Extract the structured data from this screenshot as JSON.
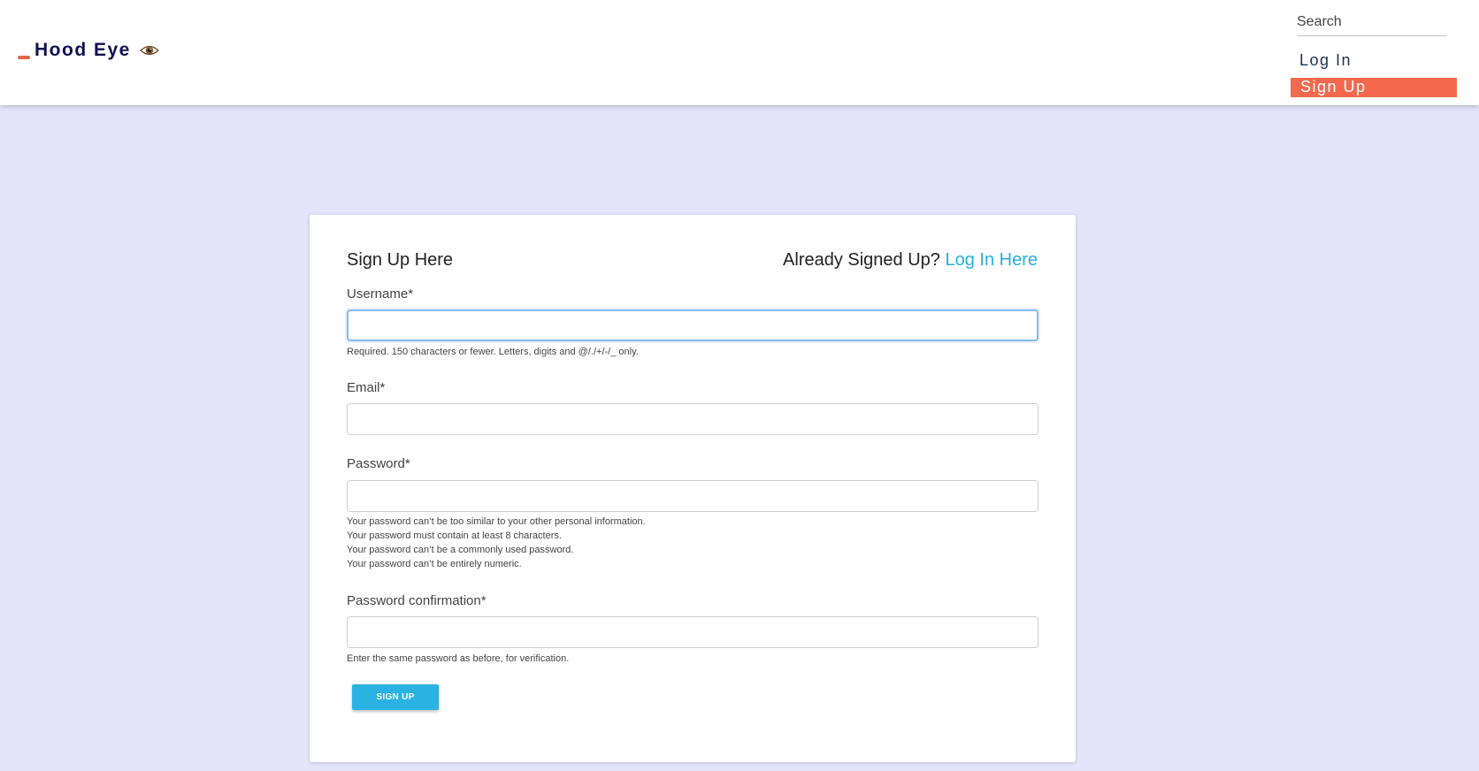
{
  "brand": {
    "name": "Hood Eye",
    "icon": "eye-icon"
  },
  "nav": {
    "search_placeholder": "Search",
    "login_label": "Log In",
    "signup_label": "Sign Up"
  },
  "form": {
    "title": "Sign Up Here",
    "already_text": "Already Signed Up?",
    "login_link": "Log In Here",
    "username_label": "Username*",
    "username_value": "",
    "username_help": "Required. 150 characters or fewer. Letters, digits and @/./+/-/_ only.",
    "email_label": "Email*",
    "email_value": "",
    "password_label": "Password*",
    "password_value": "",
    "password_help": [
      "Your password can’t be too similar to your other personal information.",
      "Your password must contain at least 8 characters.",
      "Your password can’t be a commonly used password.",
      "Your password can’t be entirely numeric."
    ],
    "confirm_label": "Password confirmation*",
    "confirm_value": "",
    "confirm_help": "Enter the same password as before, for verification.",
    "submit_label": "SIGN UP"
  },
  "colors": {
    "background": "#e4e4fb",
    "brand_text": "#10104f",
    "accent_orange": "#f4694e",
    "link_blue": "#28aee0",
    "button_blue": "#2ab2e2"
  }
}
